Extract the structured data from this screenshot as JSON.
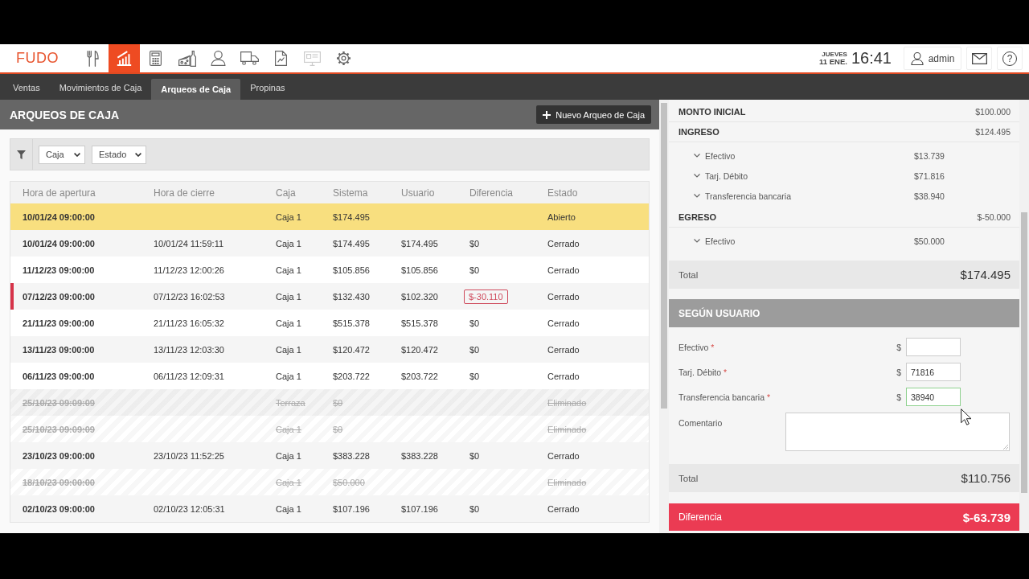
{
  "header": {
    "logo": "FUDO",
    "nav": [
      {
        "selected": false,
        "disabled": false
      },
      {
        "selected": true,
        "disabled": false
      },
      {
        "selected": false,
        "disabled": false
      },
      {
        "selected": false,
        "disabled": false
      },
      {
        "selected": false,
        "disabled": false
      },
      {
        "selected": false,
        "disabled": false
      },
      {
        "selected": false,
        "disabled": false
      },
      {
        "selected": false,
        "disabled": true
      },
      {
        "selected": false,
        "disabled": false
      }
    ],
    "weekday": "JUEVES",
    "date": "11 ENE.",
    "time": "16:41",
    "user": "admin",
    "help": "?"
  },
  "tabs": [
    {
      "label": "Ventas",
      "selected": false
    },
    {
      "label": "Movimientos de Caja",
      "selected": false
    },
    {
      "label": "Arqueos de Caja",
      "selected": true
    },
    {
      "label": "Propinas",
      "selected": false
    }
  ],
  "panel": {
    "title": "ARQUEOS DE CAJA",
    "new_button": "Nuevo Arqueo de Caja",
    "filters": [
      {
        "value": "Caja"
      },
      {
        "value": "Estado"
      }
    ]
  },
  "table": {
    "columns": [
      "Hora de apertura",
      "Hora de cierre",
      "Caja",
      "Sistema",
      "Usuario",
      "Diferencia",
      "Estado"
    ],
    "rows": [
      {
        "opened": "10/01/24 09:00:00",
        "register": "Caja 1",
        "system": "$174.495",
        "status": "Abierto",
        "selected": true,
        "deleted": false,
        "mismatch": false
      },
      {
        "opened": "10/01/24 09:00:00",
        "closed": "10/01/24 11:59:11",
        "register": "Caja 1",
        "system": "$174.495",
        "user": "$174.495",
        "difference": "$0",
        "status": "Cerrado",
        "selected": false,
        "deleted": false,
        "mismatch": false
      },
      {
        "opened": "11/12/23 09:00:00",
        "closed": "11/12/23 12:00:26",
        "register": "Caja 1",
        "system": "$105.856",
        "user": "$105.856",
        "difference": "$0",
        "status": "Cerrado",
        "selected": false,
        "deleted": false,
        "mismatch": false
      },
      {
        "opened": "07/12/23 09:00:00",
        "closed": "07/12/23 16:02:53",
        "register": "Caja 1",
        "system": "$132.430",
        "user": "$102.320",
        "difference": "$-30.110",
        "status": "Cerrado",
        "selected": false,
        "deleted": false,
        "mismatch": true
      },
      {
        "opened": "21/11/23 09:00:00",
        "closed": "21/11/23 16:05:32",
        "register": "Caja 1",
        "system": "$515.378",
        "user": "$515.378",
        "difference": "$0",
        "status": "Cerrado",
        "selected": false,
        "deleted": false,
        "mismatch": false
      },
      {
        "opened": "13/11/23 09:00:00",
        "closed": "13/11/23 12:03:30",
        "register": "Caja 1",
        "system": "$120.472",
        "user": "$120.472",
        "difference": "$0",
        "status": "Cerrado",
        "selected": false,
        "deleted": false,
        "mismatch": false
      },
      {
        "opened": "06/11/23 09:00:00",
        "closed": "06/11/23 12:09:31",
        "register": "Caja 1",
        "system": "$203.722",
        "user": "$203.722",
        "difference": "$0",
        "status": "Cerrado",
        "selected": false,
        "deleted": false,
        "mismatch": false
      },
      {
        "opened": "25/10/23 09:09:09",
        "register": "Terraza",
        "system": "$0",
        "status": "Eliminado",
        "selected": false,
        "deleted": true,
        "mismatch": false
      },
      {
        "opened": "25/10/23 09:09:09",
        "register": "Caja 1",
        "system": "$0",
        "status": "Eliminado",
        "selected": false,
        "deleted": true,
        "mismatch": false
      },
      {
        "opened": "23/10/23 09:00:00",
        "closed": "23/10/23 11:52:25",
        "register": "Caja 1",
        "system": "$383.228",
        "user": "$383.228",
        "difference": "$0",
        "status": "Cerrado",
        "selected": false,
        "deleted": false,
        "mismatch": false
      },
      {
        "opened": "18/10/23 09:00:00",
        "register": "Caja 1",
        "system": "$50.000",
        "status": "Eliminado",
        "selected": false,
        "deleted": true,
        "mismatch": false
      },
      {
        "opened": "02/10/23 09:00:00",
        "closed": "02/10/23 12:05:31",
        "register": "Caja 1",
        "system": "$107.196",
        "user": "$107.196",
        "difference": "$0",
        "status": "Cerrado",
        "selected": false,
        "deleted": false,
        "mismatch": false
      }
    ]
  },
  "summary": {
    "sections": [
      {
        "label": "MONTO INICIAL",
        "amount": "$100.000"
      },
      {
        "label": "INGRESO",
        "amount": "$124.495",
        "items": [
          {
            "label": "Efectivo",
            "amount": "$13.739"
          },
          {
            "label": "Tarj. Débito",
            "amount": "$71.816"
          },
          {
            "label": "Transferencia bancaria",
            "amount": "$38.940"
          }
        ]
      },
      {
        "label": "EGRESO",
        "amount": "$-50.000",
        "items": [
          {
            "label": "Efectivo",
            "amount": "$50.000"
          }
        ]
      }
    ],
    "total": {
      "label": "Total",
      "amount": "$174.495"
    }
  },
  "user_count": {
    "title": "SEGÚN USUARIO",
    "fields": [
      {
        "label": "Efectivo",
        "required_mark": "*",
        "currency": "$",
        "focused": false
      },
      {
        "label": "Tarj. Débito",
        "required_mark": "*",
        "currency": "$",
        "value": "71816",
        "focused": false
      },
      {
        "label": "Transferencia bancaria",
        "required_mark": "*",
        "currency": "$",
        "value": "38940",
        "focused": true
      }
    ],
    "comment": {
      "label": "Comentario"
    },
    "total": {
      "label": "Total",
      "amount": "$110.756"
    }
  },
  "difference": {
    "label": "Diferencia",
    "amount": "$-63.739"
  }
}
